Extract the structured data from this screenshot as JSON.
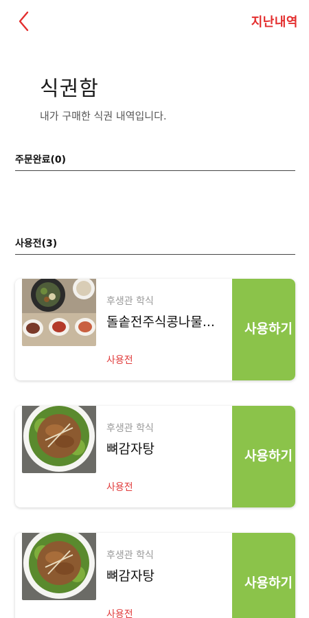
{
  "header": {
    "back_icon": "chevron-left-icon",
    "history_link": "지난내역",
    "accent_color": "#e32d2d"
  },
  "page": {
    "title": "식권함",
    "subtitle": "내가 구매한 식권 내역입니다."
  },
  "sections": {
    "completed_label": "주문완료(0)",
    "unused_label": "사용전(3)"
  },
  "tickets": [
    {
      "cafeteria": "후생관 학식",
      "menu": "돌솥전주식콩나물...",
      "status": "사용전",
      "action": "사용하기",
      "image": "bibimbap-set-photo"
    },
    {
      "cafeteria": "후생관 학식",
      "menu": "뼈감자탕",
      "status": "사용전",
      "action": "사용하기",
      "image": "gamjatang-photo"
    },
    {
      "cafeteria": "후생관 학식",
      "menu": "뼈감자탕",
      "status": "사용전",
      "action": "사용하기",
      "image": "gamjatang-photo"
    }
  ],
  "colors": {
    "use_button": "#8bc34a",
    "status_text": "#e03a3a"
  }
}
